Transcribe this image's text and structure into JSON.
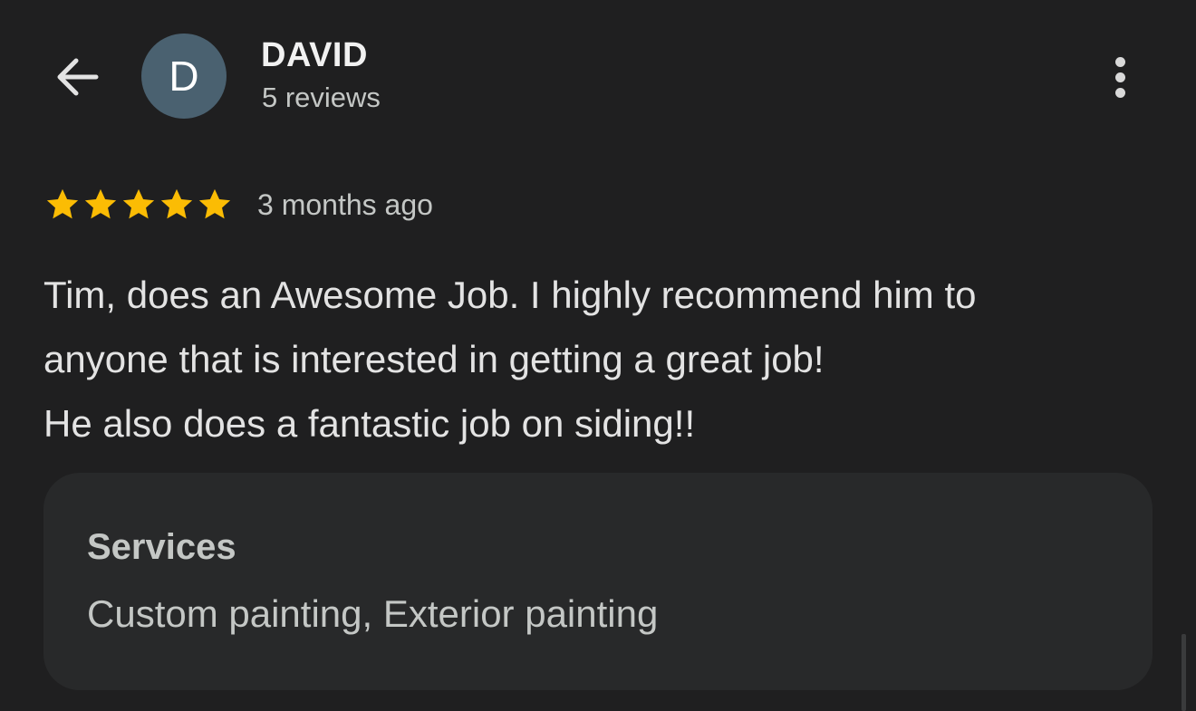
{
  "header": {
    "back_icon": "arrow-back-icon",
    "avatar_initial": "D",
    "avatar_color": "#4a6170",
    "reviewer_name": "DAVID",
    "review_count": "5 reviews",
    "more_icon": "more-vert-icon"
  },
  "review": {
    "rating": 5,
    "rating_max": 5,
    "star_color": "#fbbc04",
    "date": "3 months ago",
    "text_lines": [
      "Tim, does an Awesome Job. I highly recommend him to",
      "anyone that is interested in getting a great job!",
      "He also does a fantastic job on siding!!"
    ]
  },
  "services": {
    "title": "Services",
    "value": "Custom painting, Exterior painting"
  },
  "colors": {
    "background": "#1f1f20",
    "card": "#28292a"
  }
}
